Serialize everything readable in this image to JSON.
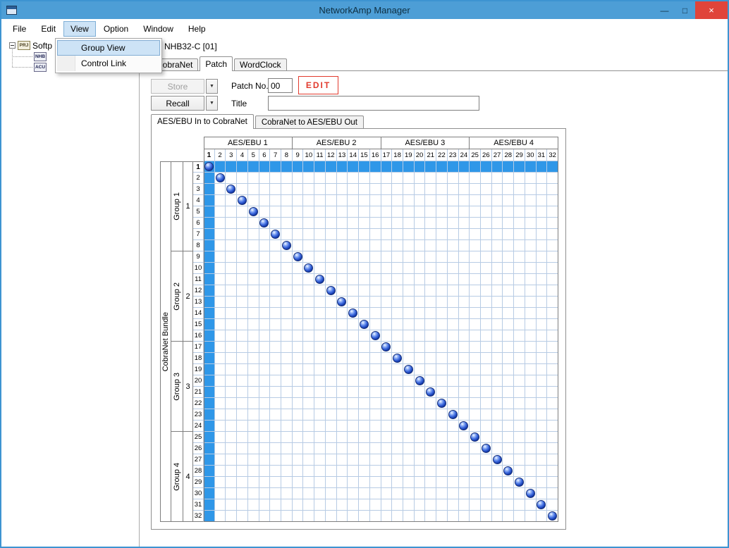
{
  "window": {
    "title": "NetworkAmp Manager",
    "controls": [
      {
        "name": "minimize",
        "glyph": "—"
      },
      {
        "name": "maximize",
        "glyph": "□"
      },
      {
        "name": "close",
        "glyph": "×"
      }
    ]
  },
  "menubar": {
    "items": [
      {
        "label": "File"
      },
      {
        "label": "Edit"
      },
      {
        "label": "View",
        "active": true
      },
      {
        "label": "Option"
      },
      {
        "label": "Window"
      },
      {
        "label": "Help"
      }
    ]
  },
  "view_menu": {
    "items": [
      {
        "label": "Group View",
        "highlighted": true
      },
      {
        "label": "Control Link"
      }
    ]
  },
  "tree": {
    "root": {
      "icon": "PRJ",
      "label": "Softp"
    },
    "children": [
      {
        "icon": "NHB",
        "label": ""
      },
      {
        "icon": "ACU",
        "label": ""
      }
    ]
  },
  "document": {
    "title": "NHB32-C [01]",
    "tabs": [
      {
        "label": "CobraNet"
      },
      {
        "label": "Patch",
        "selected": true
      },
      {
        "label": "WordClock"
      }
    ]
  },
  "patch_controls": {
    "store_label": "Store",
    "recall_label": "Recall",
    "dropdown_icon": "▼",
    "patch_no_label": "Patch No.",
    "patch_no_value": "00",
    "edit_label": "EDIT",
    "title_label": "Title",
    "title_value": ""
  },
  "patch_tabs": [
    {
      "label": "AES/EBU In to CobraNet",
      "selected": true
    },
    {
      "label": "CobraNet to AES/EBU Out",
      "selected": false
    }
  ],
  "matrix": {
    "row_axis_label": "CobraNet Bundle",
    "col_groups": [
      "AES/EBU 1",
      "AES/EBU 2",
      "AES/EBU 3",
      "AES/EBU 4"
    ],
    "row_groups": [
      {
        "label": "Group 1",
        "number": "1"
      },
      {
        "label": "Group 2",
        "number": "2"
      },
      {
        "label": "Group 3",
        "number": "3"
      },
      {
        "label": "Group 4",
        "number": "4"
      }
    ],
    "rows": 32,
    "cols": 32,
    "col_numbers": [
      1,
      2,
      3,
      4,
      5,
      6,
      7,
      8,
      9,
      10,
      11,
      12,
      13,
      14,
      15,
      16,
      17,
      18,
      19,
      20,
      21,
      22,
      23,
      24,
      25,
      26,
      27,
      28,
      29,
      30,
      31,
      32
    ],
    "row_numbers": [
      1,
      2,
      3,
      4,
      5,
      6,
      7,
      8,
      9,
      10,
      11,
      12,
      13,
      14,
      15,
      16,
      17,
      18,
      19,
      20,
      21,
      22,
      23,
      24,
      25,
      26,
      27,
      28,
      29,
      30,
      31,
      32
    ],
    "selected_row": 1,
    "selected_col": 1,
    "patches": [
      [
        1,
        1
      ],
      [
        2,
        2
      ],
      [
        3,
        3
      ],
      [
        4,
        4
      ],
      [
        5,
        5
      ],
      [
        6,
        6
      ],
      [
        7,
        7
      ],
      [
        8,
        8
      ],
      [
        9,
        9
      ],
      [
        10,
        10
      ],
      [
        11,
        11
      ],
      [
        12,
        12
      ],
      [
        13,
        13
      ],
      [
        14,
        14
      ],
      [
        15,
        15
      ],
      [
        16,
        16
      ],
      [
        17,
        17
      ],
      [
        18,
        18
      ],
      [
        19,
        19
      ],
      [
        20,
        20
      ],
      [
        21,
        21
      ],
      [
        22,
        22
      ],
      [
        23,
        23
      ],
      [
        24,
        24
      ],
      [
        25,
        25
      ],
      [
        26,
        26
      ],
      [
        27,
        27
      ],
      [
        28,
        28
      ],
      [
        29,
        29
      ],
      [
        30,
        30
      ],
      [
        31,
        31
      ],
      [
        32,
        32
      ]
    ]
  },
  "colors": {
    "titlebar": "#4d9ed6",
    "window_border": "#3d94d1",
    "close_button": "#e0443a",
    "selection": "#2f97e8",
    "grid_line": "#b7cbe4",
    "edit_red": "#e23b2e",
    "menu_highlight": "#cde3f6",
    "ball": "#1742c8"
  }
}
